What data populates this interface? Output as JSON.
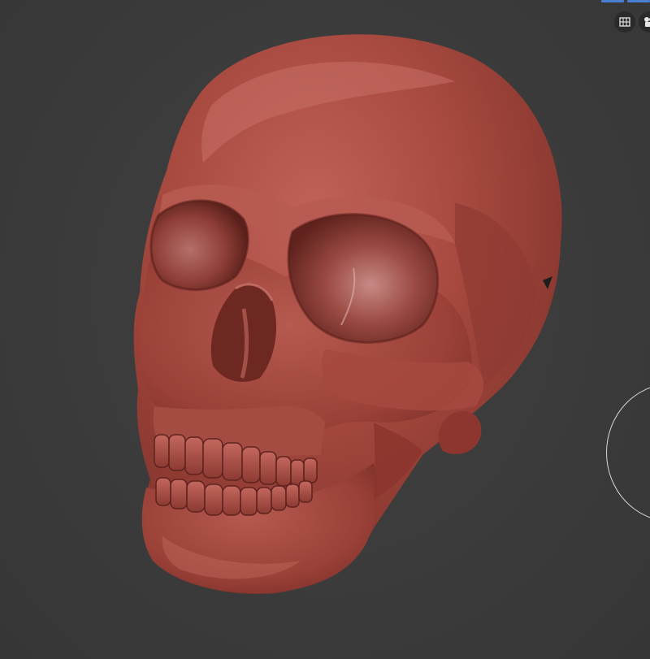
{
  "viewport": {
    "background_color": "#3b3b3b",
    "object": {
      "name": "skull",
      "material_color": "#a8483e"
    }
  },
  "toolbar": {
    "grid_toggle_icon": "grid-icon",
    "camera_icon": "camera-icon",
    "accent_color": "#4a7fd4"
  },
  "gizmo": {
    "icon": "navigation-gizmo"
  }
}
